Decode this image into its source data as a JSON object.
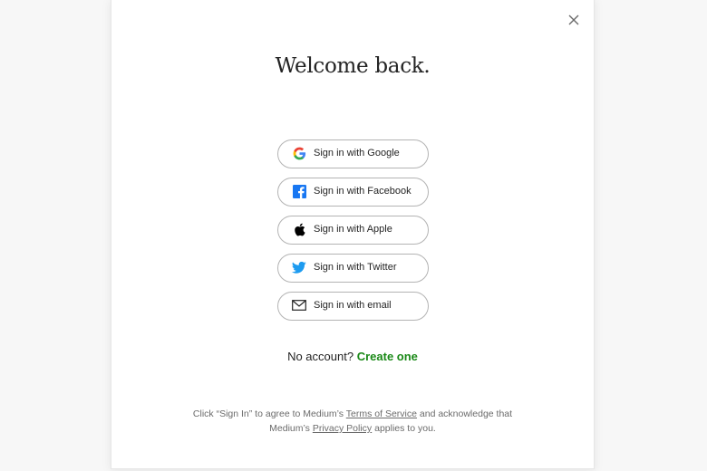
{
  "modal": {
    "title": "Welcome back.",
    "close_icon": "close-icon"
  },
  "auth_buttons": [
    {
      "label": "Sign in with Google",
      "icon": "google-icon"
    },
    {
      "label": "Sign in with Facebook",
      "icon": "facebook-icon"
    },
    {
      "label": "Sign in with Apple",
      "icon": "apple-icon"
    },
    {
      "label": "Sign in with Twitter",
      "icon": "twitter-icon"
    },
    {
      "label": "Sign in with email",
      "icon": "email-icon"
    }
  ],
  "signup": {
    "prompt": "No account?",
    "link": "Create one"
  },
  "legal": {
    "line1_pre": "Click “Sign In” to agree to Medium’s",
    "terms": "Terms of Service",
    "line1_post": "and acknowledge that",
    "line2_pre": "Medium’s",
    "privacy": "Privacy Policy",
    "line2_post": "applies to you."
  },
  "colors": {
    "accent_green": "#1a8917",
    "text": "#242424",
    "muted": "#6b6b6b",
    "border": "#b3b3b3"
  }
}
